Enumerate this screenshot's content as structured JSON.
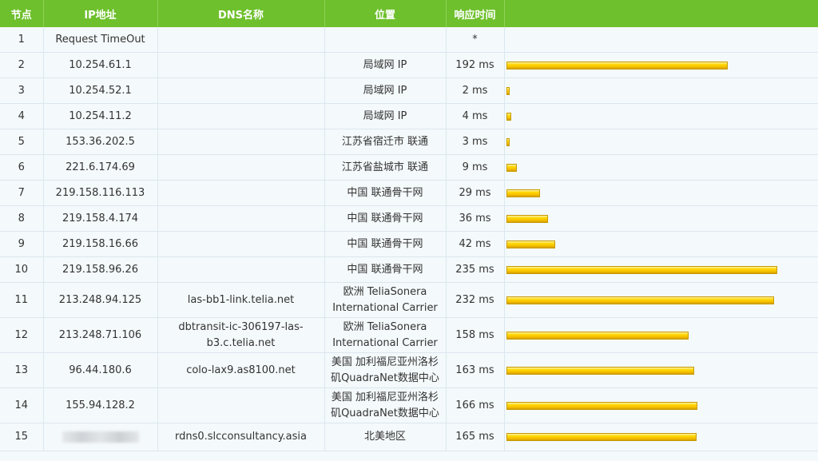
{
  "headers": {
    "node": "节点",
    "ip": "IP地址",
    "dns": "DNS名称",
    "location": "位置",
    "response": "响应时间"
  },
  "hops": [
    {
      "node": "1",
      "ip": "Request TimeOut",
      "dns": "",
      "location": "",
      "response": "*",
      "ms": null
    },
    {
      "node": "2",
      "ip": "10.254.61.1",
      "dns": "",
      "location": "局域网 IP",
      "response": "192 ms",
      "ms": 192
    },
    {
      "node": "3",
      "ip": "10.254.52.1",
      "dns": "",
      "location": "局域网 IP",
      "response": "2 ms",
      "ms": 2
    },
    {
      "node": "4",
      "ip": "10.254.11.2",
      "dns": "",
      "location": "局域网 IP",
      "response": "4 ms",
      "ms": 4
    },
    {
      "node": "5",
      "ip": "153.36.202.5",
      "dns": "",
      "location": "江苏省宿迁市 联通",
      "response": "3 ms",
      "ms": 3
    },
    {
      "node": "6",
      "ip": "221.6.174.69",
      "dns": "",
      "location": "江苏省盐城市 联通",
      "response": "9 ms",
      "ms": 9
    },
    {
      "node": "7",
      "ip": "219.158.116.113",
      "dns": "",
      "location": "中国 联通骨干网",
      "response": "29 ms",
      "ms": 29
    },
    {
      "node": "8",
      "ip": "219.158.4.174",
      "dns": "",
      "location": "中国 联通骨干网",
      "response": "36 ms",
      "ms": 36
    },
    {
      "node": "9",
      "ip": "219.158.16.66",
      "dns": "",
      "location": "中国 联通骨干网",
      "response": "42 ms",
      "ms": 42
    },
    {
      "node": "10",
      "ip": "219.158.96.26",
      "dns": "",
      "location": "中国 联通骨干网",
      "response": "235 ms",
      "ms": 235
    },
    {
      "node": "11",
      "ip": "213.248.94.125",
      "dns": "las-bb1-link.telia.net",
      "location": "欧洲 TeliaSonera International Carrier",
      "response": "232 ms",
      "ms": 232
    },
    {
      "node": "12",
      "ip": "213.248.71.106",
      "dns": "dbtransit-ic-306197-las-b3.c.telia.net",
      "location": "欧洲 TeliaSonera International Carrier",
      "response": "158 ms",
      "ms": 158
    },
    {
      "node": "13",
      "ip": "96.44.180.6",
      "dns": "colo-lax9.as8100.net",
      "location": "美国 加利福尼亚州洛杉矶QuadraNet数据中心",
      "response": "163 ms",
      "ms": 163
    },
    {
      "node": "14",
      "ip": "155.94.128.2",
      "dns": "",
      "location": "美国 加利福尼亚州洛杉矶QuadraNet数据中心",
      "response": "166 ms",
      "ms": 166
    },
    {
      "node": "15",
      "ip": "",
      "dns": "rdns0.slcconsultancy.asia",
      "location": "北美地区",
      "response": "165 ms",
      "ms": 165
    }
  ]
}
